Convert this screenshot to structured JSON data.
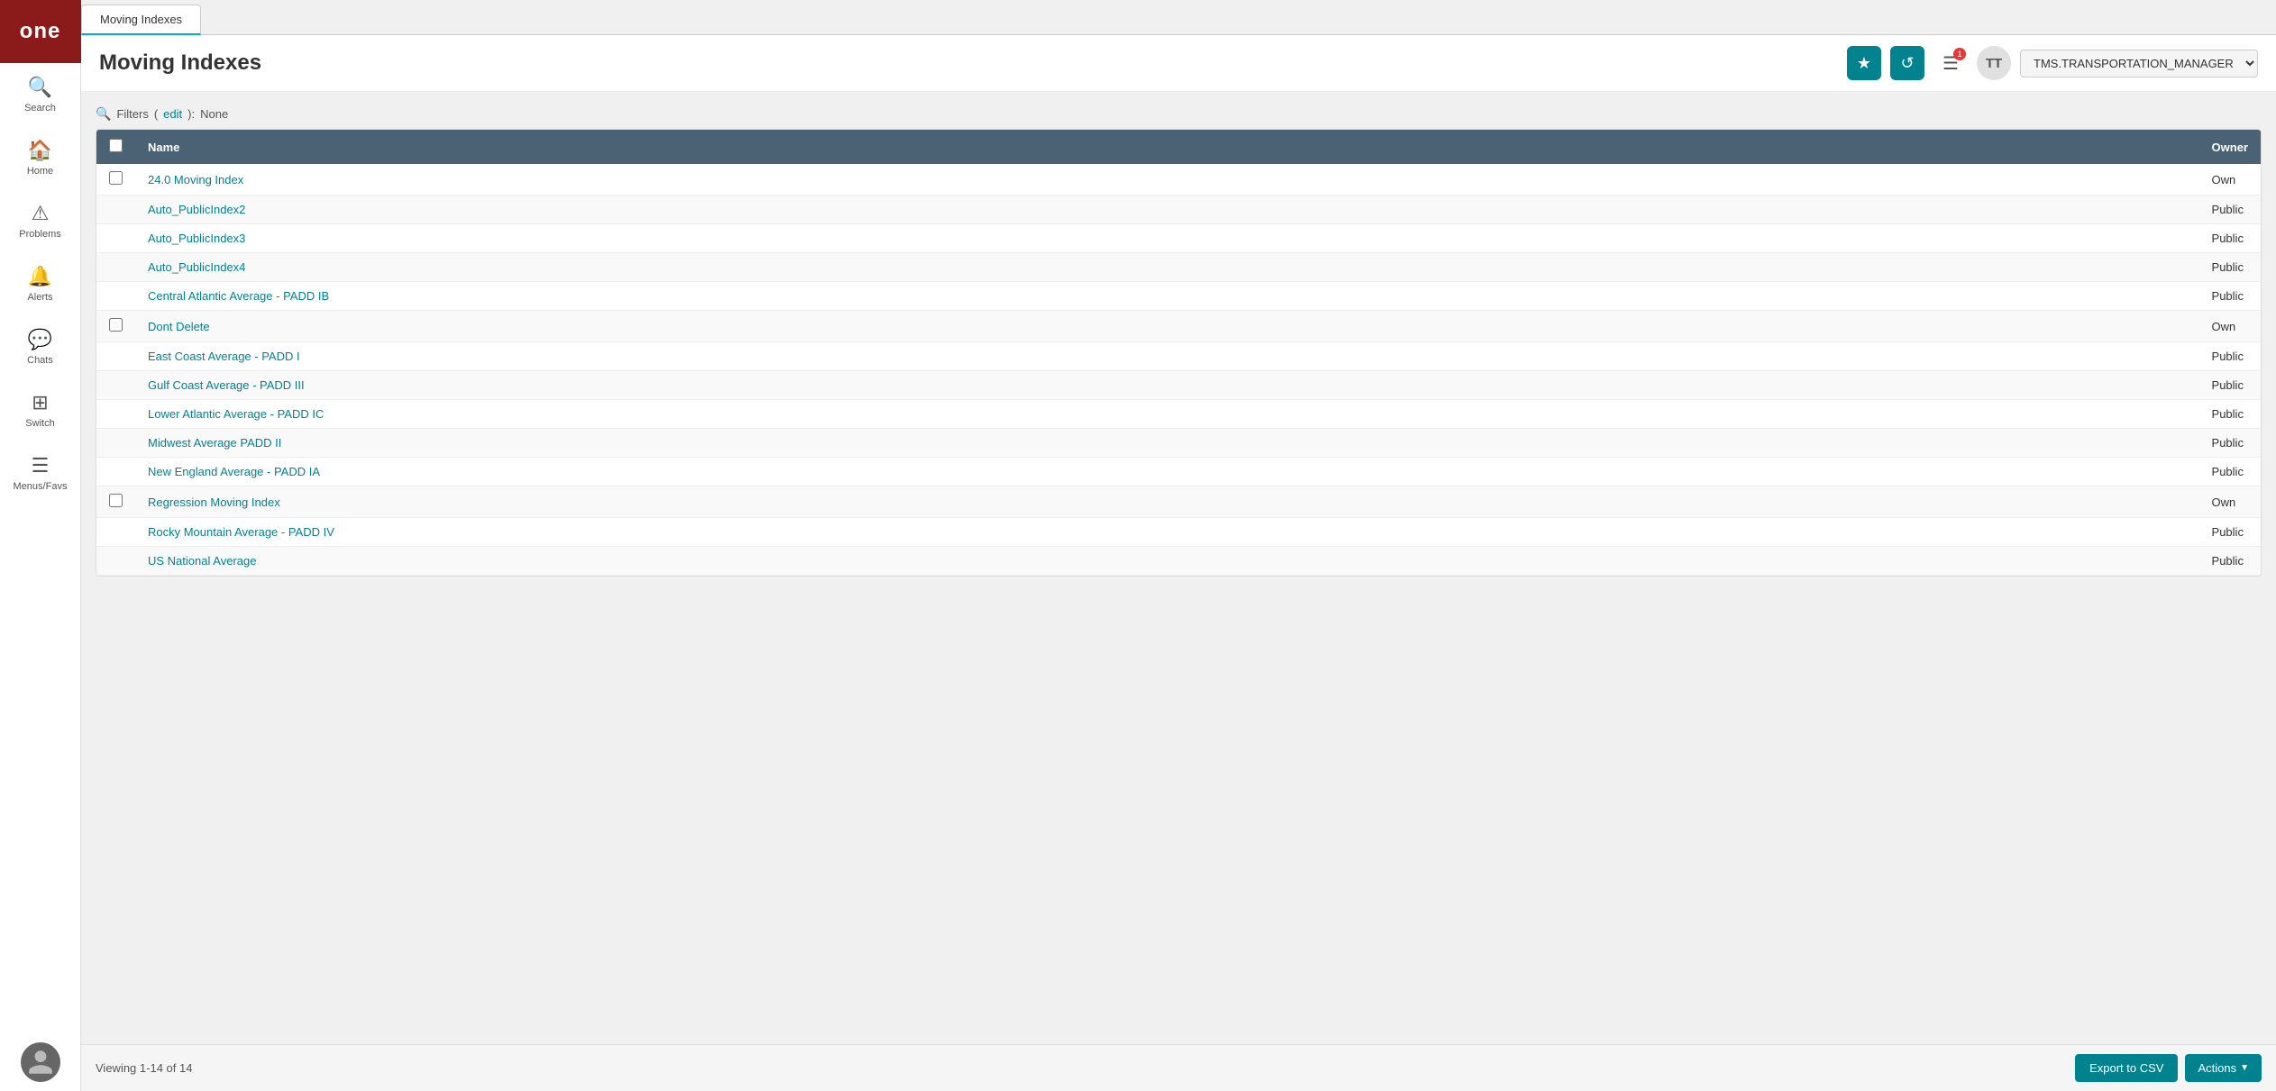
{
  "app": {
    "logo": "one",
    "tab_label": "Moving Indexes"
  },
  "header": {
    "title": "Moving Indexes",
    "star_btn_label": "★",
    "refresh_btn_label": "↺",
    "menu_btn_label": "☰",
    "notification_count": "1",
    "user_initials": "TT",
    "user_role": "TMS.TRANSPORTATION_MANAGER",
    "dropdown_arrow": "▼"
  },
  "filters": {
    "label": "Filters",
    "edit_label": "edit",
    "value": "None"
  },
  "table": {
    "columns": [
      "Name",
      "Owner"
    ],
    "rows": [
      {
        "name": "24.0 Moving Index",
        "owner": "Own"
      },
      {
        "name": "Auto_PublicIndex2",
        "owner": "Public"
      },
      {
        "name": "Auto_PublicIndex3",
        "owner": "Public"
      },
      {
        "name": "Auto_PublicIndex4",
        "owner": "Public"
      },
      {
        "name": "Central Atlantic Average - PADD IB",
        "owner": "Public"
      },
      {
        "name": "Dont Delete",
        "owner": "Own"
      },
      {
        "name": "East Coast Average - PADD I",
        "owner": "Public"
      },
      {
        "name": "Gulf Coast Average - PADD III",
        "owner": "Public"
      },
      {
        "name": "Lower Atlantic Average - PADD IC",
        "owner": "Public"
      },
      {
        "name": "Midwest Average PADD II",
        "owner": "Public"
      },
      {
        "name": "New England Average - PADD IA",
        "owner": "Public"
      },
      {
        "name": "Regression Moving Index",
        "owner": "Own"
      },
      {
        "name": "Rocky Mountain Average - PADD IV",
        "owner": "Public"
      },
      {
        "name": "US National Average",
        "owner": "Public"
      }
    ]
  },
  "footer": {
    "viewing_text": "Viewing 1-14 of 14",
    "export_btn": "Export to CSV",
    "actions_btn": "Actions"
  },
  "sidebar": {
    "items": [
      {
        "label": "Search",
        "icon": "🔍"
      },
      {
        "label": "Home",
        "icon": "🏠"
      },
      {
        "label": "Problems",
        "icon": "⚠"
      },
      {
        "label": "Alerts",
        "icon": "🔔"
      },
      {
        "label": "Chats",
        "icon": "💬"
      },
      {
        "label": "Switch",
        "icon": "⊞"
      },
      {
        "label": "Menus/Favs",
        "icon": "☰"
      }
    ]
  }
}
